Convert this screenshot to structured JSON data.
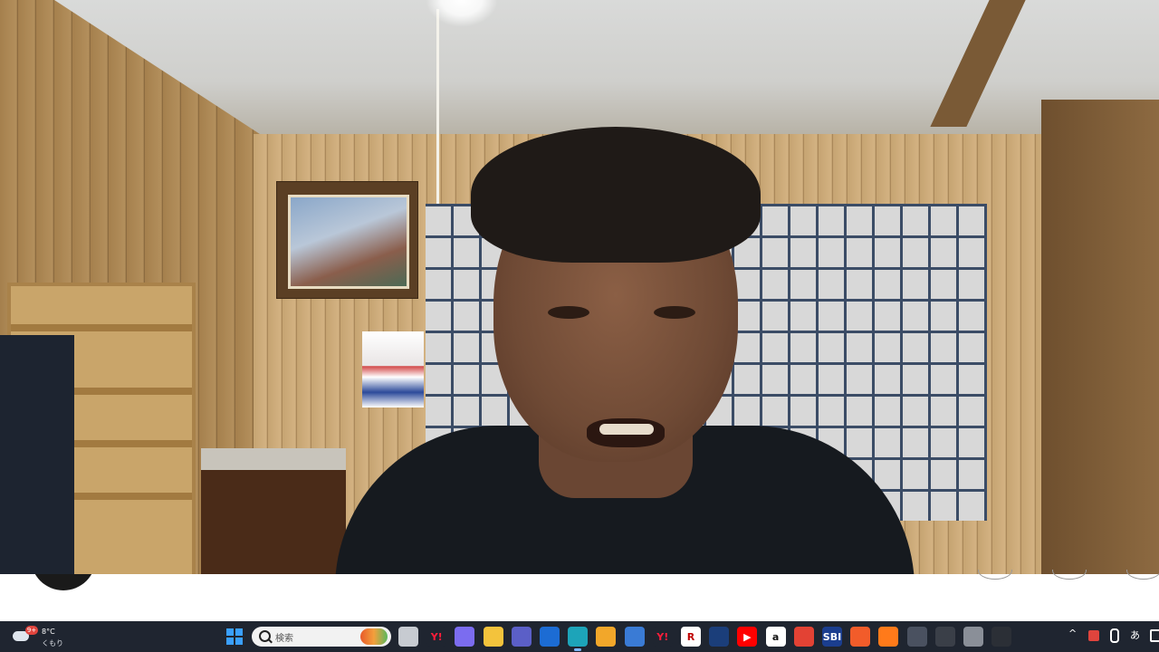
{
  "taskbar": {
    "weather": {
      "icon": "cloud-icon",
      "badge": "9+",
      "temperature": "8°C",
      "condition": "くもり"
    },
    "start_icon": "windows-start-icon",
    "search": {
      "placeholder": "検索",
      "icon": "search-icon"
    },
    "apps": [
      {
        "name": "task-view-icon",
        "glyph": "",
        "color": "#c7cbd1"
      },
      {
        "name": "yahoo-icon",
        "glyph": "Y!",
        "color": "#1f2530",
        "text_color": "#ff1d3a"
      },
      {
        "name": "copilot-icon",
        "glyph": "",
        "color": "#7b6cf0"
      },
      {
        "name": "file-explorer-icon",
        "glyph": "",
        "color": "#f3c33c"
      },
      {
        "name": "teams-icon",
        "glyph": "",
        "color": "#5b5fc7"
      },
      {
        "name": "edge-beta-icon",
        "glyph": "",
        "color": "#1c6cd4"
      },
      {
        "name": "edge-icon",
        "glyph": "",
        "color": "#1da4b9",
        "active": true
      },
      {
        "name": "chrome-canary-icon",
        "glyph": "",
        "color": "#f2a72a"
      },
      {
        "name": "microsoft-store-icon",
        "glyph": "",
        "color": "#3a7bd5"
      },
      {
        "name": "yahoo-shopping-icon",
        "glyph": "Y!",
        "color": "#1f2530",
        "text_color": "#ff1d3a"
      },
      {
        "name": "rakuten-icon",
        "glyph": "R",
        "color": "#ffffff",
        "text_color": "#bf0000"
      },
      {
        "name": "news-app-icon",
        "glyph": "",
        "color": "#1b3e7a"
      },
      {
        "name": "youtube-icon",
        "glyph": "▶",
        "color": "#ff0000"
      },
      {
        "name": "amazon-icon",
        "glyph": "a",
        "color": "#ffffff",
        "text_color": "#111111"
      },
      {
        "name": "sports-app-icon",
        "glyph": "",
        "color": "#e34234"
      },
      {
        "name": "sbi-icon",
        "glyph": "SBI",
        "color": "#1b3e8f"
      },
      {
        "name": "shopping-bag-icon",
        "glyph": "",
        "color": "#f25c2a"
      },
      {
        "name": "firefox-icon",
        "glyph": "",
        "color": "#ff7a1a"
      },
      {
        "name": "network-app-icon",
        "glyph": "",
        "color": "#4a5160"
      },
      {
        "name": "obs-icon",
        "glyph": "",
        "color": "#3a3f48"
      },
      {
        "name": "chrome-icon",
        "glyph": "",
        "color": "#8a8f98"
      },
      {
        "name": "camera-app-icon",
        "glyph": "",
        "color": "#2b2f36"
      }
    ],
    "tray": {
      "chevron": "^",
      "ime": "あ"
    }
  }
}
